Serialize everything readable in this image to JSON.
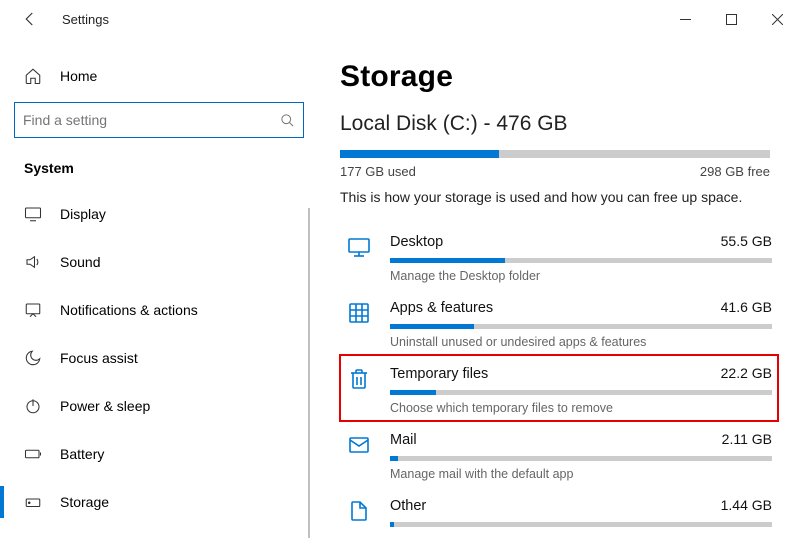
{
  "window": {
    "title": "Settings"
  },
  "sidebar": {
    "home": "Home",
    "searchPlaceholder": "Find a setting",
    "section": "System",
    "items": [
      {
        "label": "Display"
      },
      {
        "label": "Sound"
      },
      {
        "label": "Notifications & actions"
      },
      {
        "label": "Focus assist"
      },
      {
        "label": "Power & sleep"
      },
      {
        "label": "Battery"
      },
      {
        "label": "Storage"
      }
    ]
  },
  "page": {
    "heading": "Storage",
    "diskLabel": "Local Disk (C:) - 476 GB",
    "usedText": "177 GB used",
    "freeText": "298 GB free",
    "usedPercent": 37,
    "description": "This is how your storage is used and how you can free up space.",
    "items": [
      {
        "title": "Desktop",
        "size": "55.5 GB",
        "sub": "Manage the Desktop folder",
        "pct": 30,
        "icon": "monitor",
        "highlight": false
      },
      {
        "title": "Apps & features",
        "size": "41.6 GB",
        "sub": "Uninstall unused or undesired apps & features",
        "pct": 22,
        "icon": "apps",
        "highlight": false
      },
      {
        "title": "Temporary files",
        "size": "22.2 GB",
        "sub": "Choose which temporary files to remove",
        "pct": 12,
        "icon": "trash",
        "highlight": true
      },
      {
        "title": "Mail",
        "size": "2.11 GB",
        "sub": "Manage mail with the default app",
        "pct": 2,
        "icon": "mail",
        "highlight": false
      },
      {
        "title": "Other",
        "size": "1.44 GB",
        "sub": "",
        "pct": 1,
        "icon": "file",
        "highlight": false
      }
    ]
  }
}
